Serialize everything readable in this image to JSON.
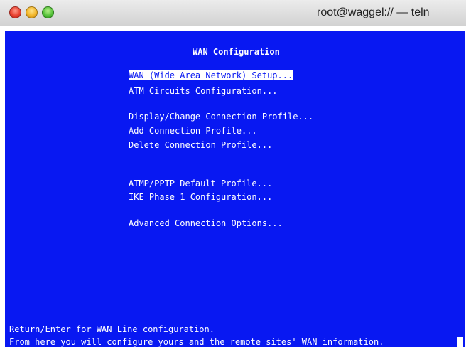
{
  "window": {
    "title": "root@waggel:// — teln"
  },
  "terminal": {
    "heading": "WAN Configuration",
    "menu": [
      {
        "label": "WAN (Wide Area Network) Setup...",
        "selected": true
      },
      {
        "label": "ATM Circuits Configuration..."
      },
      {
        "label": "Display/Change Connection Profile..."
      },
      {
        "label": "Add Connection Profile..."
      },
      {
        "label": "Delete Connection Profile..."
      },
      {
        "label": "ATMP/PPTP Default Profile..."
      },
      {
        "label": "IKE Phase 1 Configuration..."
      },
      {
        "label": "Advanced Connection Options..."
      }
    ],
    "status_lines": [
      "Return/Enter for WAN Line configuration.",
      "From here you will configure yours and the remote sites' WAN information."
    ]
  },
  "colors": {
    "terminal_background": "#0818f2",
    "terminal_text": "#ffffff"
  }
}
